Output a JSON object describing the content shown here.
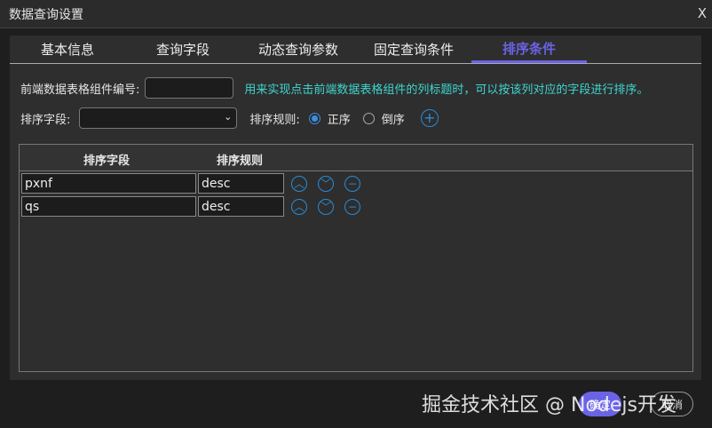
{
  "window": {
    "title": "数据查询设置",
    "close": "X"
  },
  "tabs": [
    "基本信息",
    "查询字段",
    "动态查询参数",
    "固定查询条件",
    "排序条件"
  ],
  "form": {
    "component_label": "前端数据表格组件编号:",
    "component_value": "",
    "hint": "用来实现点击前端数据表格组件的列标题时，可以按该列对应的字段进行排序。",
    "sort_field_label": "排序字段:",
    "sort_field_value": "",
    "sort_rule_label": "排序规则:",
    "asc": "正序",
    "desc": "倒序",
    "selected": "正序"
  },
  "table": {
    "headers": [
      "排序字段",
      "排序规则"
    ],
    "rows": [
      {
        "field": "pxnf",
        "rule": "desc"
      },
      {
        "field": "qs",
        "rule": "desc"
      }
    ]
  },
  "footer": {
    "ok": "确定",
    "cancel": "取消"
  },
  "watermark": "掘金技术社区 @ Nodejs开发",
  "colors": {
    "accent": "#6b63e6",
    "hint": "#3ed6d0",
    "icon": "#2a8bd6"
  }
}
